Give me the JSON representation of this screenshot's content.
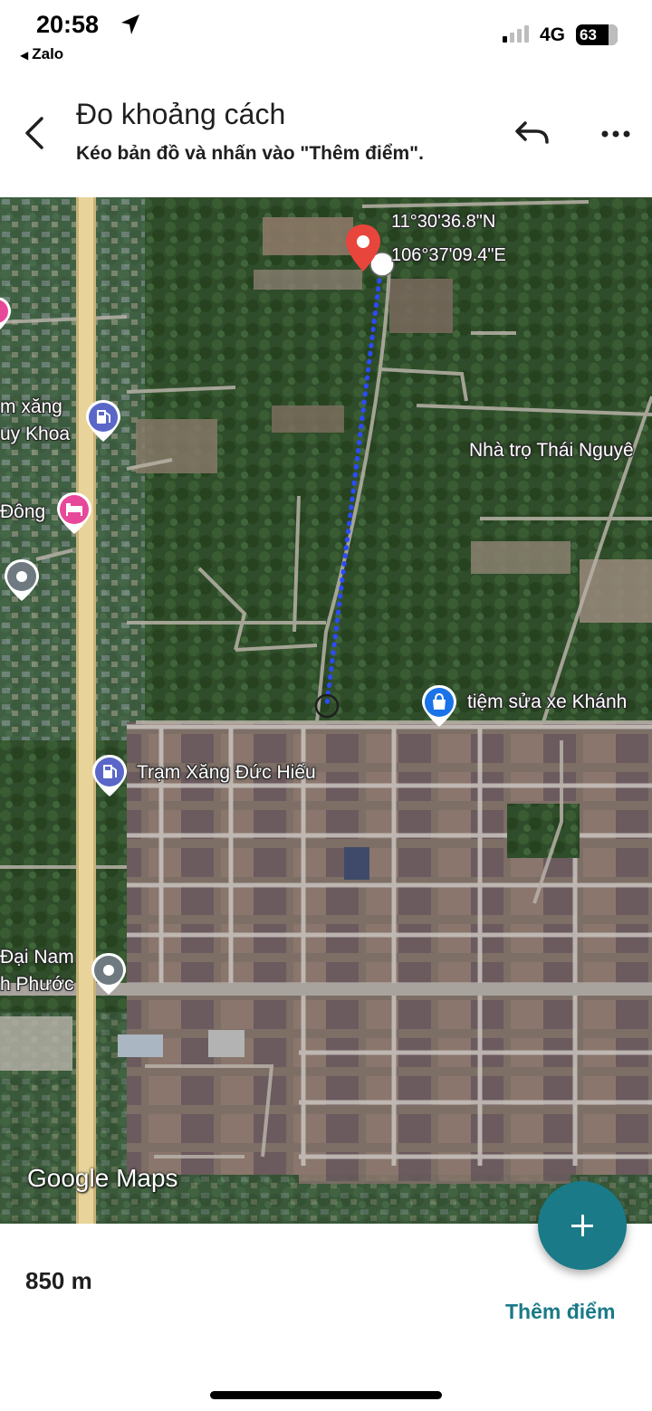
{
  "status_bar": {
    "time": "20:58",
    "back_app": "Zalo",
    "network": "4G",
    "battery": "63"
  },
  "header": {
    "title": "Đo khoảng cách",
    "subtitle": "Kéo bản đồ và nhấn vào \"Thêm điểm\".",
    "back_icon": "chevron-left",
    "undo_icon": "undo-arrow",
    "more_icon": "three-dots"
  },
  "map": {
    "pin_lat": "11°30'36.8\"N",
    "pin_lng": "106°37'09.4\"E",
    "labels": {
      "tram_xang_duc_hieu": "Trạm Xăng Đức Hiếu",
      "tiem_sua_xe": "tiệm sửa xe Khánh",
      "nha_tro": "Nhà trọ Thái Nguyê",
      "tram_xang_truncated": "m xăng",
      "uy_khoa": "uy Khoa",
      "dong": "Đông",
      "dai_nam": "Đại Nam",
      "h_phuoc": "h Phước"
    },
    "logo": "Google Maps",
    "colors": {
      "route_line": "#2a4bff",
      "pin_red": "#e8453c",
      "gas_pin": "#5a67c8",
      "hotel_pin": "#e8489a",
      "shop_pin": "#1a73e8",
      "generic_pin": "#6f7a80"
    }
  },
  "actions": {
    "add_point": "Thêm điểm",
    "fab_icon": "plus"
  },
  "result": {
    "distance": "850 m"
  }
}
